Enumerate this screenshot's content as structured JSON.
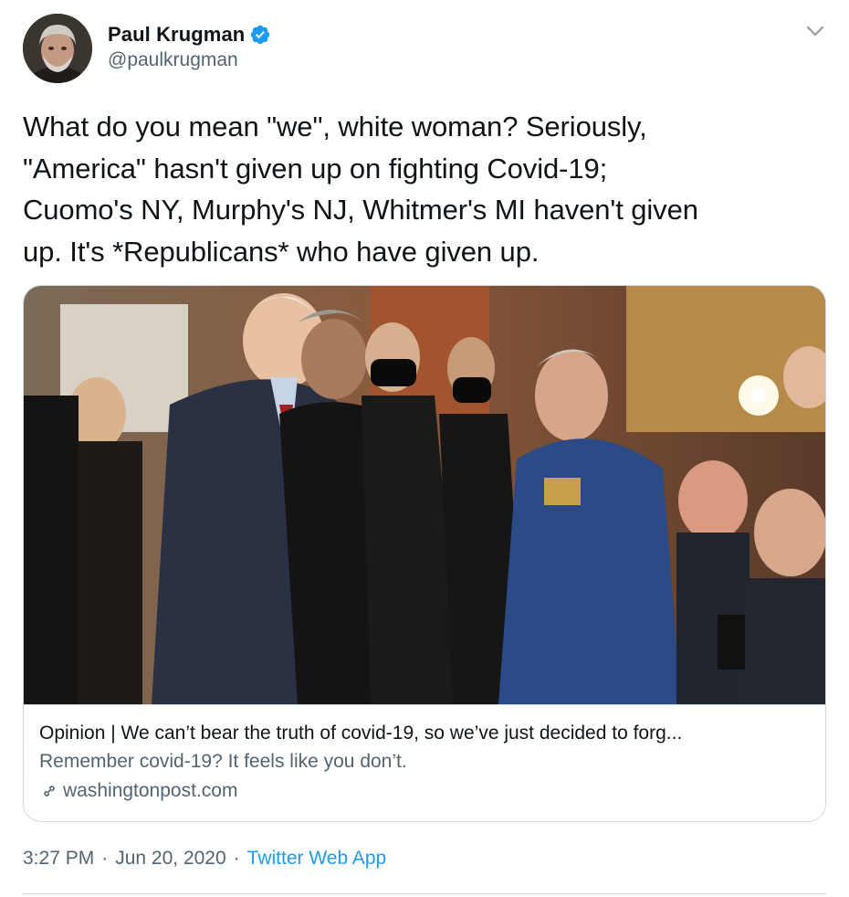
{
  "author": {
    "display_name": "Paul Krugman",
    "handle": "@paulkrugman",
    "verified": true,
    "avatar_icon": "profile-photo"
  },
  "tweet": {
    "text": "What do you mean \"we\", white woman? Seriously,\n\"America\" hasn't given up on fighting Covid-19;\nCuomo's NY, Murphy's NJ, Whitmer's MI haven't given\nup. It's *Republicans* who have given up."
  },
  "card": {
    "image_icon": "article-photo",
    "title": "Opinion | We can’t bear the truth of covid-19, so we’ve just decided to forg...",
    "description": "Remember covid-19? It feels like you don’t.",
    "domain": "washingtonpost.com",
    "domain_icon": "link-icon"
  },
  "meta": {
    "time": "3:27 PM",
    "date": "Jun 20, 2020",
    "separator": "·",
    "source": "Twitter Web App"
  },
  "colors": {
    "text_primary": "#0f1419",
    "text_secondary": "#536471",
    "accent": "#1d9bf0",
    "border": "#cfd9de"
  }
}
